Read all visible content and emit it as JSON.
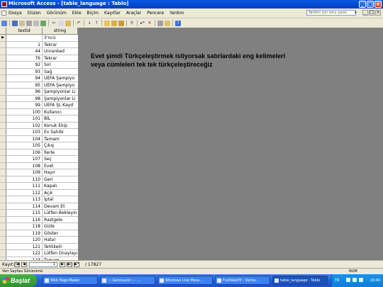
{
  "window": {
    "title": "Microsoft Access - [table_language : Tablo]",
    "buttons": {
      "minimize": "_",
      "maximize": "□",
      "close": "×"
    }
  },
  "menubar": {
    "items": [
      "Dosya",
      "Düzen",
      "Görünüm",
      "Ekle",
      "Biçim",
      "Kayıtlar",
      "Araçlar",
      "Pencere",
      "Yardım"
    ],
    "help_placeholder": "Yardım için soru yazın"
  },
  "datasheet": {
    "columns": [
      "textid",
      "string"
    ],
    "rows": [
      {
        "id": "",
        "text": "3'ncü",
        "marker": "▶"
      },
      {
        "id": "1",
        "text": "Tekrar"
      },
      {
        "id": "44",
        "text": "Unranked"
      },
      {
        "id": "76",
        "text": "Tekrar"
      },
      {
        "id": "92",
        "text": "Sol"
      },
      {
        "id": "93",
        "text": "Sağ"
      },
      {
        "id": "94",
        "text": "UEFA Şampiyo"
      },
      {
        "id": "95",
        "text": "UEFA Şampiyo"
      },
      {
        "id": "96",
        "text": "Şampiyonlar Li"
      },
      {
        "id": "98",
        "text": "Şampiyonlar Li"
      },
      {
        "id": "99",
        "text": "UEFA ŞL Kayd"
      },
      {
        "id": "100",
        "text": "Kullanıcı"
      },
      {
        "id": "101",
        "text": "BİL"
      },
      {
        "id": "102",
        "text": "Konuk Ekip"
      },
      {
        "id": "103",
        "text": "Ev Sahibi"
      },
      {
        "id": "104",
        "text": "Tamam"
      },
      {
        "id": "105",
        "text": "Çıkış"
      },
      {
        "id": "106",
        "text": "İlerle"
      },
      {
        "id": "107",
        "text": "Seç"
      },
      {
        "id": "108",
        "text": "Evet"
      },
      {
        "id": "109",
        "text": "Hayır"
      },
      {
        "id": "110",
        "text": "Geri"
      },
      {
        "id": "111",
        "text": "Kapalı"
      },
      {
        "id": "112",
        "text": "Açık"
      },
      {
        "id": "113",
        "text": "İptal"
      },
      {
        "id": "114",
        "text": "Devam Et"
      },
      {
        "id": "115",
        "text": "Lütfen Bekleyin"
      },
      {
        "id": "116",
        "text": "Rastgele"
      },
      {
        "id": "118",
        "text": "Gizle"
      },
      {
        "id": "119",
        "text": "Göster"
      },
      {
        "id": "120",
        "text": "Hata!"
      },
      {
        "id": "121",
        "text": "Tehlikeli!"
      },
      {
        "id": "122",
        "text": "Lütfen Onaylayı"
      },
      {
        "id": "123",
        "text": "Tamam"
      }
    ]
  },
  "note": {
    "line1": "Evet şimdi Türkçeleştirmek istiyorsak satırlardaki eng kelimeleri",
    "line2": "veya cümleleri tek tek türkçeleştireceğiz"
  },
  "navigator": {
    "label": "Kayıt:",
    "current": "1",
    "total": "/ 17827",
    "first": "|◀",
    "prev": "◀",
    "next": "▶",
    "last": "▶|",
    "new": "▶*"
  },
  "statusbar": {
    "text": "Veri Sayfası Görünümü",
    "num": "NUM"
  },
  "taskbar": {
    "start": "Başlat",
    "tasks": [
      "Web Page Maker",
      "::: GencLand :: - ...",
      "Windows Live Mess...",
      "FunPaketTr : Verita...",
      "table_language : Tablo"
    ],
    "lang": "TR",
    "clock": "19:40"
  }
}
